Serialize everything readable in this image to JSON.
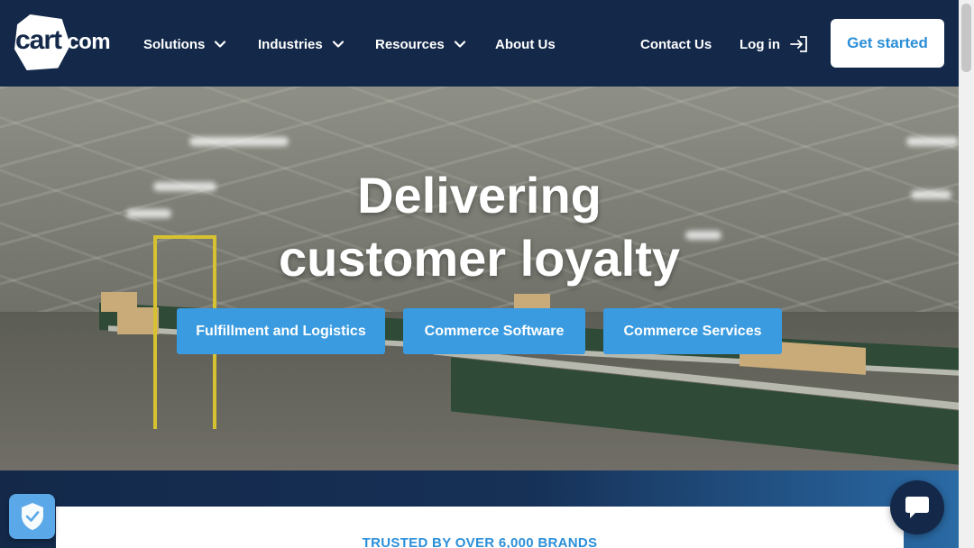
{
  "header": {
    "logo": {
      "word": "cart",
      "suffix": ".com"
    },
    "nav": [
      {
        "label": "Solutions",
        "has_dropdown": true
      },
      {
        "label": "Industries",
        "has_dropdown": true
      },
      {
        "label": "Resources",
        "has_dropdown": true
      },
      {
        "label": "About Us",
        "has_dropdown": false
      }
    ],
    "contact_label": "Contact Us",
    "login_label": "Log in",
    "cta_label": "Get started"
  },
  "hero": {
    "title_line1": "Delivering",
    "title_line2": "customer loyalty",
    "buttons": [
      {
        "label": "Fulfillment and Logistics"
      },
      {
        "label": "Commerce Software"
      },
      {
        "label": "Commerce Services"
      }
    ]
  },
  "trusted": {
    "label": "TRUSTED BY OVER 6,000 BRANDS"
  },
  "widgets": {
    "shield_icon": "shield-check-icon",
    "chat_icon": "chat-bubble-icon"
  },
  "colors": {
    "navy": "#14294a",
    "accent_blue": "#3a9be0",
    "cta_text": "#2b8fd8"
  }
}
